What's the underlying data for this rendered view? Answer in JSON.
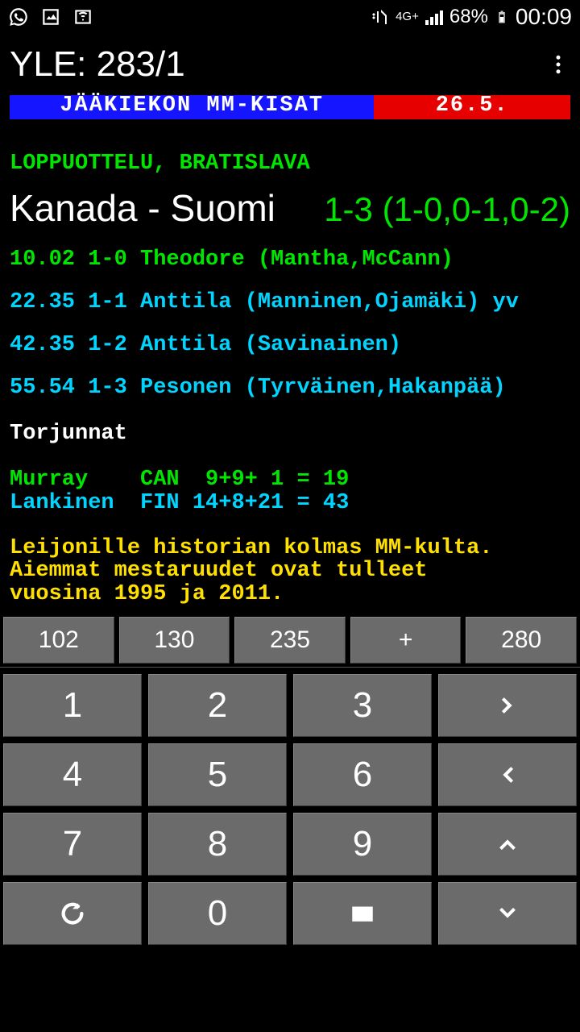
{
  "status": {
    "battery_pct": "68%",
    "time": "00:09",
    "network": "4G+"
  },
  "app": {
    "title": "YLE: 283/1"
  },
  "teletext": {
    "header_left": "JÄÄKIEKON MM-KISAT",
    "header_right": "26.5.",
    "subtitle": "LOPPUOTTELU, BRATISLAVA",
    "match": {
      "teams": "Kanada  - Suomi",
      "score": "1-3 (1-0,0-1,0-2)"
    },
    "events": [
      {
        "cls": "green",
        "text": "10.02 1-0 Theodore (Mantha,McCann)"
      },
      {
        "cls": "cyan",
        "text": "22.35 1-1 Anttila (Manninen,Ojamäki) yv"
      },
      {
        "cls": "cyan",
        "text": "42.35 1-2 Anttila (Savinainen)"
      },
      {
        "cls": "cyan",
        "text": "55.54 1-3 Pesonen (Tyrväinen,Hakanpää)"
      }
    ],
    "saves_title": "Torjunnat",
    "saves": [
      {
        "cls": "green",
        "text": "Murray    CAN  9+9+ 1 = 19"
      },
      {
        "cls": "cyan",
        "text": "Lankinen  FIN 14+8+21 = 43"
      }
    ],
    "footer": "Leijonille historian kolmas MM-kulta.\nAiemmat mestaruudet ovat tulleet\nvuosina 1995 ja 2011."
  },
  "shortcuts": [
    "102",
    "130",
    "235",
    "+",
    "280"
  ],
  "keypad": {
    "k1": "1",
    "k2": "2",
    "k3": "3",
    "k4": "4",
    "k5": "5",
    "k6": "6",
    "k7": "7",
    "k8": "8",
    "k9": "9",
    "k0": "0"
  }
}
